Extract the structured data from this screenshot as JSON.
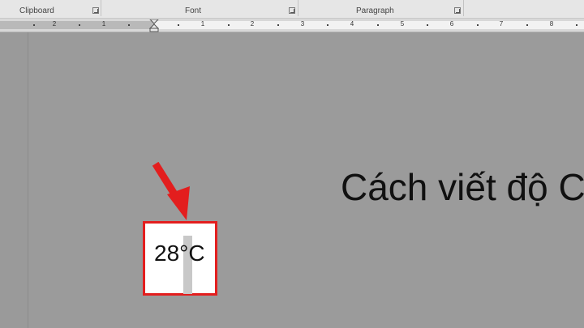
{
  "ribbon": {
    "groups": [
      {
        "label": "Clipboard"
      },
      {
        "label": "Font"
      },
      {
        "label": "Paragraph"
      }
    ]
  },
  "ruler": {
    "numbers": [
      "2",
      "1",
      "1",
      "2",
      "3",
      "4",
      "5",
      "6",
      "7",
      "8"
    ]
  },
  "document": {
    "heading": "Cách viết độ C",
    "temperature_text": "28°C"
  },
  "colors": {
    "highlight_border": "#e31e1e",
    "arrow": "#e31e1e"
  },
  "icons": [
    "dialog-launcher-icon",
    "indent-marker-icon",
    "red-arrow-icon"
  ]
}
